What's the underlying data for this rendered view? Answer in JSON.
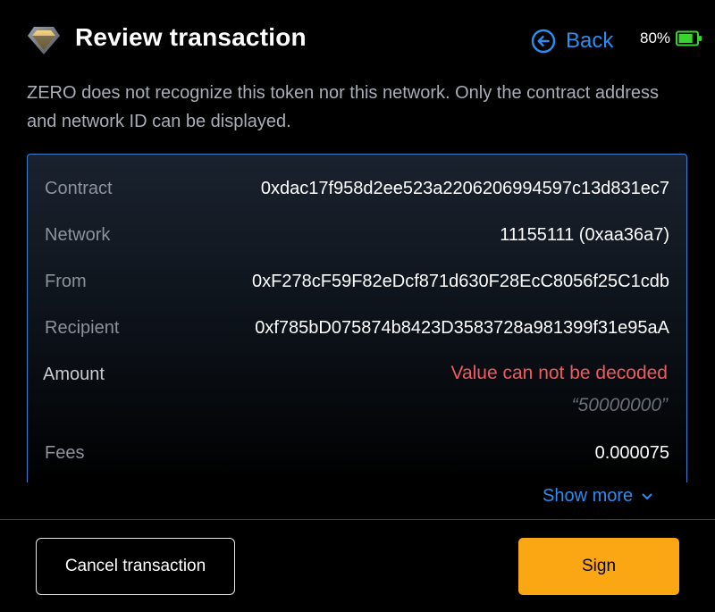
{
  "header": {
    "title": "Review transaction",
    "logo_icon": "zero-diamond-logo",
    "back_label": "Back",
    "back_icon": "arrow-left-circle-icon",
    "battery_percent": "80%",
    "battery_level": 0.8,
    "battery_color": "#38d430"
  },
  "notice": "ZERO does not recognize this token nor this network. Only the contract address and network ID can be displayed.",
  "details": {
    "contract": {
      "label": "Contract",
      "value": "0xdac17f958d2ee523a2206206994597c13d831ec7"
    },
    "network": {
      "label": "Network",
      "value": "11155111 (0xaa36a7)"
    },
    "from": {
      "label": "From",
      "value": "0xF278cF59F82eDcf871d630F28EcC8056f25C1cdb"
    },
    "recipient": {
      "label": "Recipient",
      "value": "0xf785bD075874b8423D3583728a981399f31e95aA"
    },
    "amount": {
      "label": "Amount",
      "error": "Value can not be decoded",
      "raw": "“50000000”"
    },
    "fees": {
      "label": "Fees",
      "value": "0.000075"
    }
  },
  "show_more": {
    "label": "Show more",
    "icon": "chevron-down-icon"
  },
  "footer": {
    "cancel_label": "Cancel transaction",
    "sign_label": "Sign"
  },
  "colors": {
    "accent": "#2b8ef0",
    "error": "#ee5a5f",
    "sign_button": "#fba714",
    "panel_border": "#3c7fd0"
  }
}
